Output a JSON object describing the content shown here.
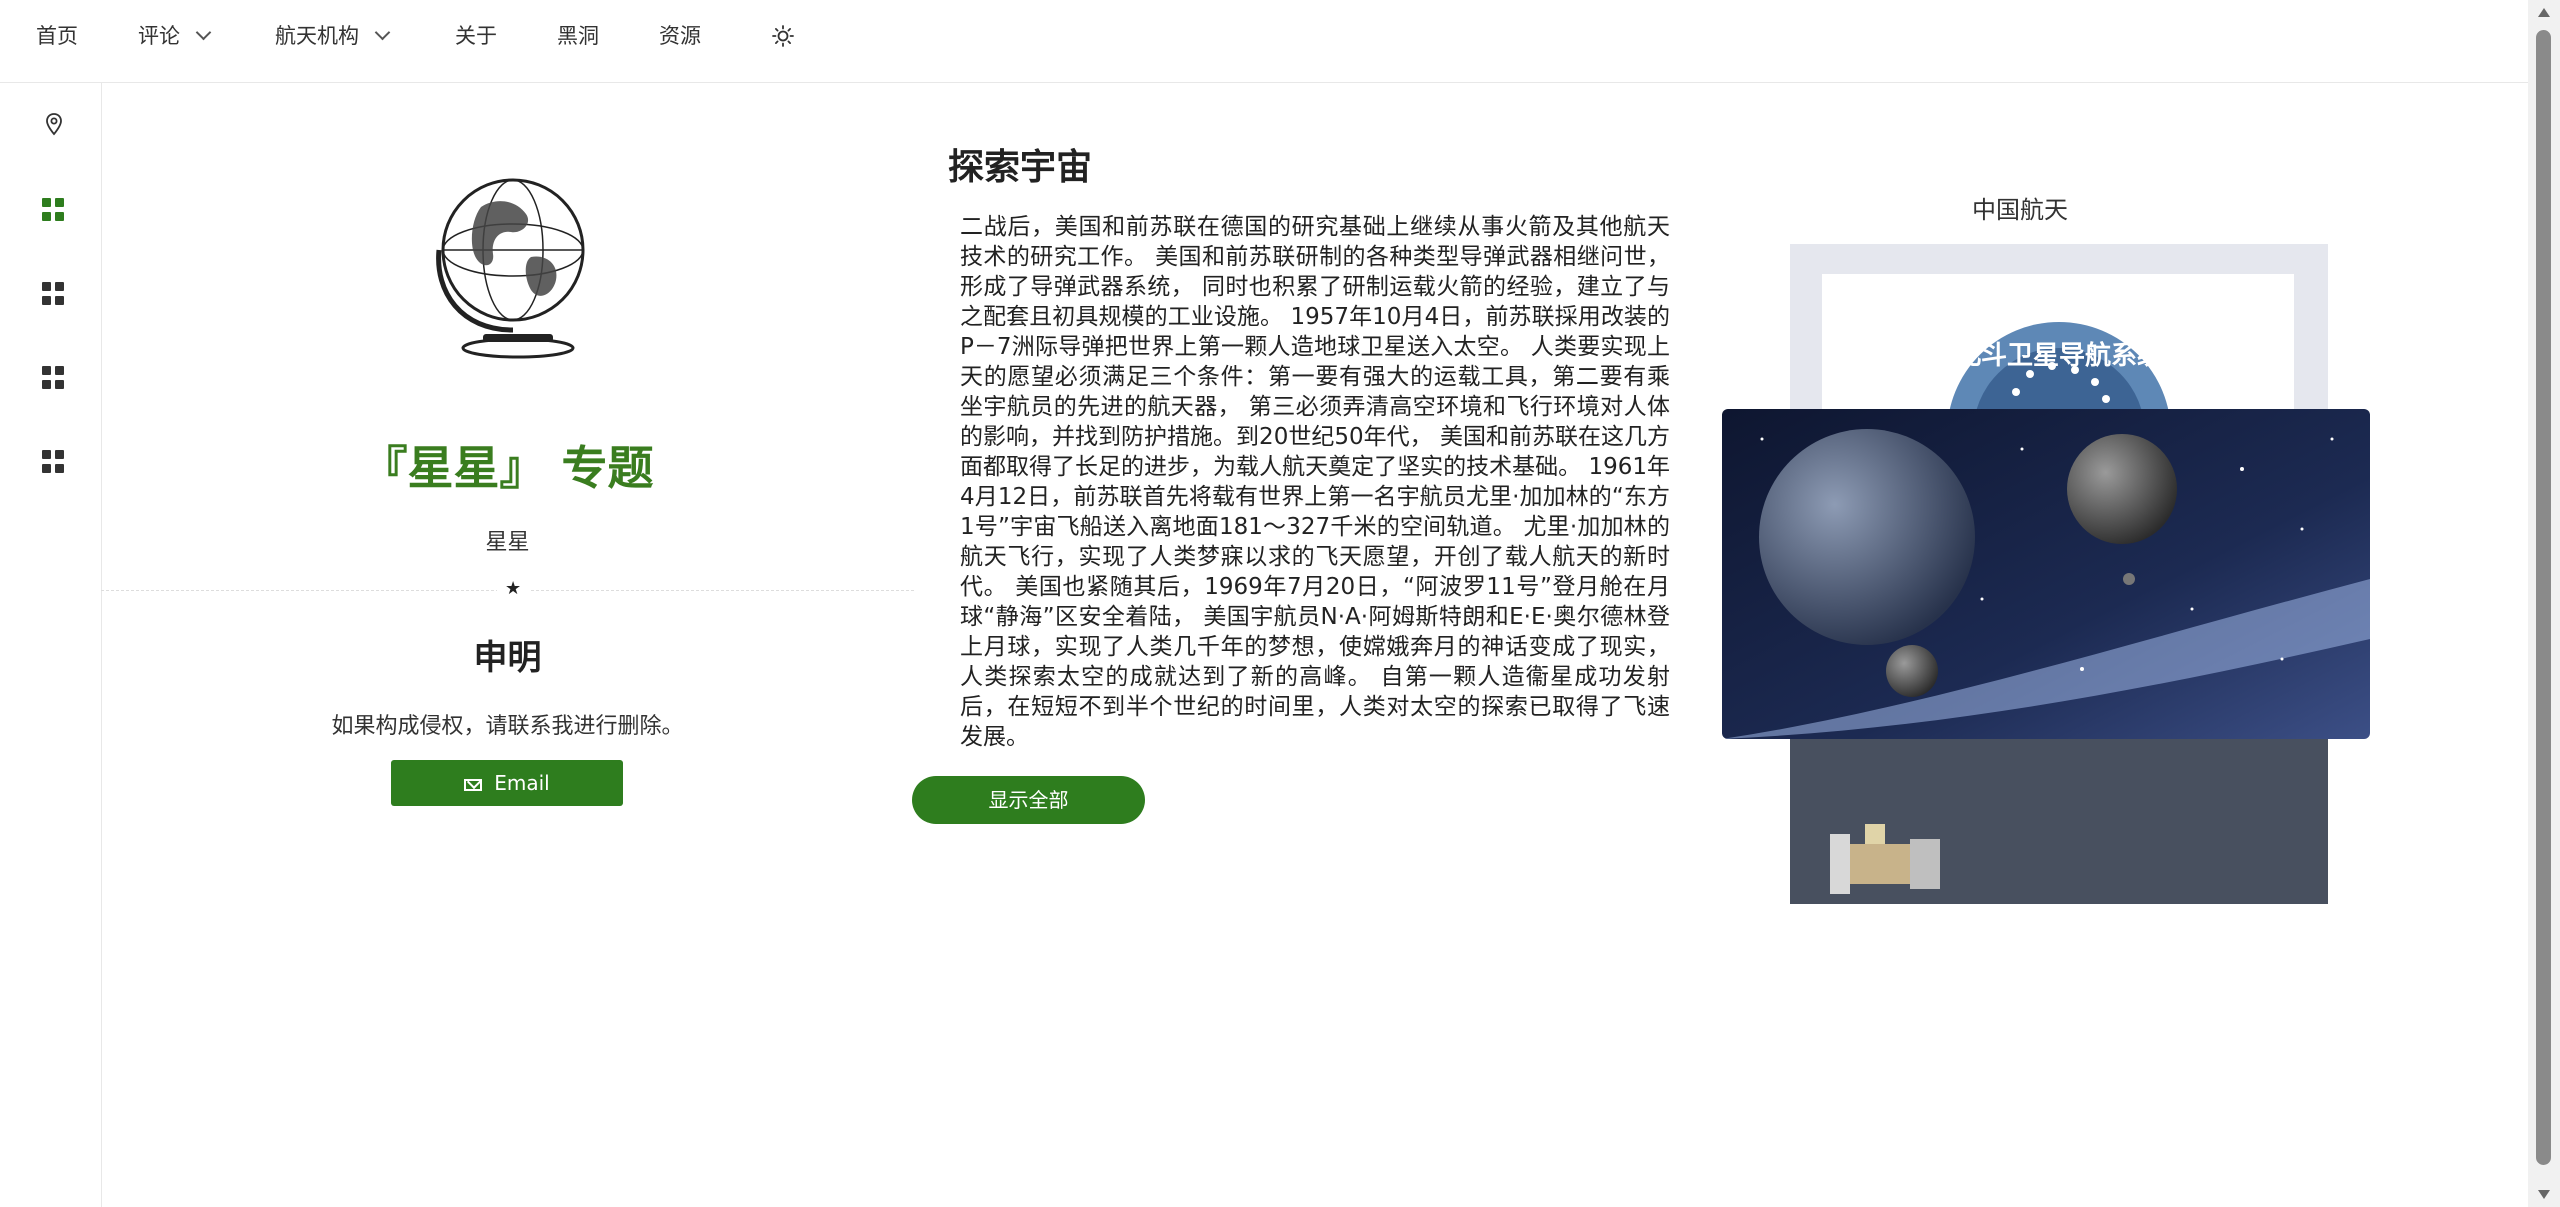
{
  "nav": {
    "items": [
      {
        "label": "首页"
      },
      {
        "label": "评论"
      },
      {
        "label": "航天机构"
      },
      {
        "label": "关于"
      },
      {
        "label": "黑洞"
      },
      {
        "label": "资源"
      }
    ]
  },
  "profile": {
    "title": "『星星』 专题",
    "subtitle": "星星",
    "declaration_title": "申明",
    "declaration_text": "如果构成侵权，请联系我进行删除。",
    "email_label": "Email"
  },
  "article": {
    "title": "探索宇宙",
    "body": "二战后，美国和前苏联在德国的研究基础上继续从事火箭及其他航天技术的研究工作。 美国和前苏联研制的各种类型导弹武器相继问世，形成了导弹武器系统， 同时也积累了研制运载火箭的经验，建立了与之配套且初具规模的工业设施。 1957年10月4日，前苏联採用改装的P－7洲际导弹把世界上第一颗人造地球卫星送入太空。 人类要实现上天的愿望必须满足三个条件：第一要有强大的运载工具，第二要有乘坐宇航员的先进的航天器， 第三必须弄清高空环境和飞行环境对人体的影响，并找到防护措施。到20世纪50年代， 美国和前苏联在这几方面都取得了长足的进步，为载人航天奠定了坚实的技术基础。 1961年4月12日，前苏联首先将载有世界上第一名宇航员尤里·加加林的“东方1号”宇宙飞船送入离地面181～327千米的空间轨道。 尤里·加加林的航天飞行，实现了人类梦寐以求的飞天愿望，开创了载人航天的新时代。 美国也紧随其后，1969年7月20日，“阿波罗11号”登月舱在月球“静海”区安全着陆， 美国宇航员N·A·阿姆斯特朗和E·E·奥尔德林登上月球，实现了人类几千年的梦想，使嫦娥奔月的神话变成了现实， 人类探索太空的成就达到了新的高峰。 自第一颗人造衞星成功发射后，在短短不到半个世纪的时间里，人类对太空的探索已取得了飞速发展。",
    "show_all_label": "显示全部"
  },
  "card": {
    "title": "中国航天",
    "logo_text": "北斗卫星导航系统"
  },
  "colors": {
    "accent": "#2e7d1e",
    "title_green": "#3a7d1f"
  },
  "icons": {
    "theme_toggle": "sun-icon",
    "rail": [
      "location-pin-icon",
      "grid-icon",
      "grid-icon",
      "grid-icon",
      "grid-icon"
    ]
  }
}
